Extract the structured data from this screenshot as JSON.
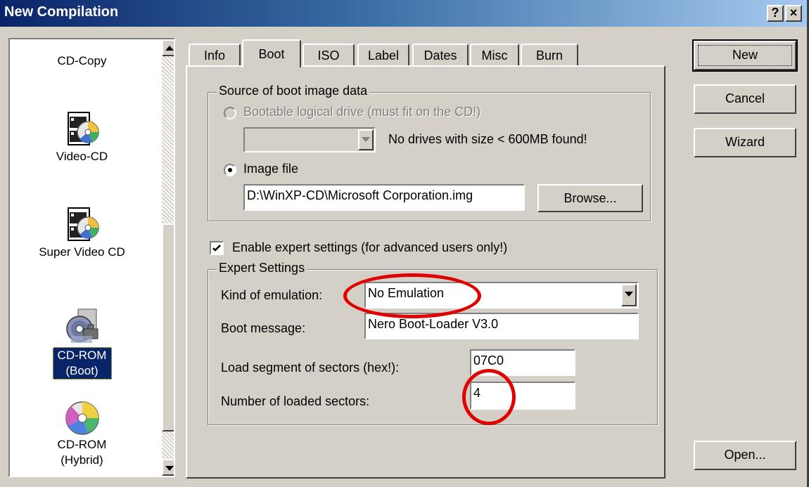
{
  "window": {
    "title": "New Compilation"
  },
  "titlebar_buttons": {
    "help": "?",
    "close": "×"
  },
  "compilation_list": {
    "items": [
      {
        "label": "CD-Copy",
        "icon": "cd-copy-icon",
        "selected": false
      },
      {
        "label": "Video-CD",
        "icon": "video-cd-icon",
        "selected": false
      },
      {
        "label": "Super Video CD",
        "icon": "super-video-cd-icon",
        "selected": false
      },
      {
        "label": "CD-ROM (Boot)",
        "icon": "cd-rom-boot-icon",
        "selected": true
      },
      {
        "label": "CD-ROM (Hybrid)",
        "icon": "cd-rom-hybrid-icon",
        "selected": false
      }
    ]
  },
  "tabs": [
    {
      "label": "Info",
      "active": false
    },
    {
      "label": "Boot",
      "active": true
    },
    {
      "label": "ISO",
      "active": false
    },
    {
      "label": "Label",
      "active": false
    },
    {
      "label": "Dates",
      "active": false
    },
    {
      "label": "Misc",
      "active": false
    },
    {
      "label": "Burn",
      "active": false
    }
  ],
  "boot": {
    "source_group_label": "Source of boot image data",
    "bootable_drive_label": "Bootable logical drive (must fit on the CD!)",
    "bootable_drive_selected": false,
    "bootable_drive_enabled": false,
    "drive_select_value": "",
    "no_drives_message": "No drives with size < 600MB found!",
    "image_file_label": "Image file",
    "image_file_selected": true,
    "image_file_path": "D:\\WinXP-CD\\Microsoft Corporation.img",
    "browse_label": "Browse...",
    "enable_expert_label": "Enable expert settings (for advanced users only!)",
    "enable_expert_checked": true,
    "expert_group_label": "Expert Settings",
    "emulation_label": "Kind of emulation:",
    "emulation_value": "No Emulation",
    "boot_message_label": "Boot message:",
    "boot_message_value": "Nero Boot-Loader V3.0",
    "load_segment_label": "Load segment of sectors (hex!):",
    "load_segment_value": "07C0",
    "loaded_sectors_label": "Number of loaded sectors:",
    "loaded_sectors_value": "4"
  },
  "buttons": {
    "new": "New",
    "cancel": "Cancel",
    "wizard": "Wizard",
    "open": "Open..."
  },
  "colors": {
    "annotation_circle": "#e00000",
    "titlebar_start": "#0a246a",
    "selection": "#0a246a",
    "face": "#d4d0c8"
  }
}
